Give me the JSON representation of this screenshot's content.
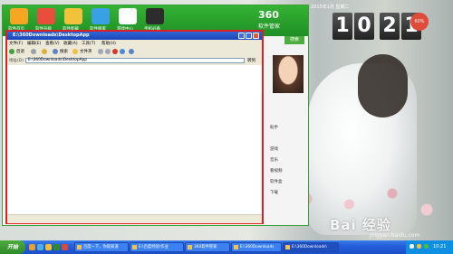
{
  "desktop": {
    "watermark": "Bai 经验",
    "watermark_sub": "jingyan.baidu.com"
  },
  "clock": {
    "date": "2015年1月 星期二",
    "digits": [
      "1",
      "0",
      "2",
      "1"
    ],
    "temp": "60%"
  },
  "app360": {
    "tabs": [
      {
        "label": "软件首页",
        "icon": "house-icon",
        "color": "#f6a623"
      },
      {
        "label": "软件升级",
        "icon": "upgrade-icon",
        "color": "#e94e3c"
      },
      {
        "label": "软件卸载",
        "icon": "trash-icon",
        "color": "#f3c13a"
      },
      {
        "label": "软件搬家",
        "icon": "monitor-icon",
        "color": "#3aa0e6"
      },
      {
        "label": "游戏中心",
        "icon": "gamepad-icon",
        "color": "#ffffff"
      },
      {
        "label": "手机必备",
        "icon": "phone-icon",
        "color": "#2c2c2c"
      }
    ],
    "logo": "360",
    "logo_sub": "软件管家",
    "search_button": "搜索",
    "side_items": [
      "助手",
      "游戏",
      "音乐",
      "看视频",
      "软件盒",
      "下载"
    ]
  },
  "explorer": {
    "title": "E:\\360Downloads\\DesktopApp",
    "menu": [
      "文件(F)",
      "编辑(E)",
      "查看(V)",
      "收藏(A)",
      "工具(T)",
      "帮助(H)"
    ],
    "toolbar": {
      "back": "后退",
      "search": "搜索",
      "folders": "文件夹"
    },
    "address_label": "地址(D)",
    "address_value": "E:\\360Downloads\\DesktopApp",
    "go_label": "转到"
  },
  "taskbar": {
    "start_label": "开始",
    "tasks": [
      "百度一下，你就知道",
      "E:\\百度经验\\作业",
      "360软件管家",
      "E:\\360Downloads",
      "E:\\360Downloads\\"
    ],
    "time": "10:21"
  },
  "colors": {
    "highlight": "#e02020",
    "brand_green": "#2ea72e",
    "xp_blue": "#245edb"
  }
}
